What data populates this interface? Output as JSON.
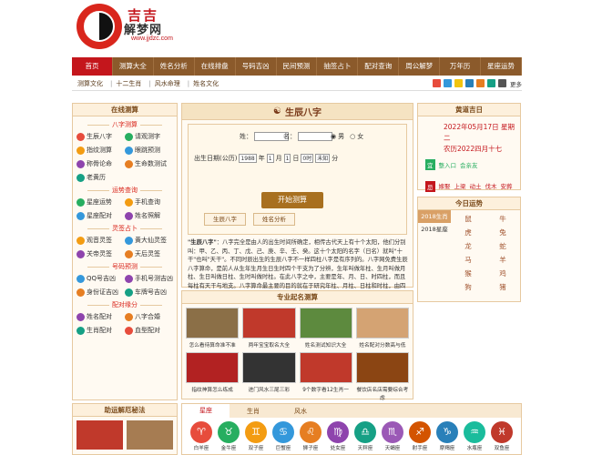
{
  "site": {
    "title": "吉吉",
    "title2": "解梦网",
    "url": "www.jjdzc.com"
  },
  "nav": [
    "首页",
    "测算大全",
    "姓名分析",
    "在线排盘",
    "号码吉凶",
    "民间预测",
    "抽签占卜",
    "配对查询",
    "周公解梦",
    "万年历",
    "星座运势"
  ],
  "subnav": [
    "测算文化",
    "十二生肖",
    "风水命理",
    "姓名文化"
  ],
  "share_more": "更多",
  "left": {
    "title": "在线测算",
    "sections": [
      {
        "name": "八字测算",
        "items": [
          "生辰八字",
          "请观测字",
          "指纹测算",
          "眼跳预测",
          "称骨论命",
          "生命数测试",
          "老黄历"
        ]
      },
      {
        "name": "运势查询",
        "items": [
          "星座运势",
          "手机查询",
          "星座配对",
          "姓名照解"
        ]
      },
      {
        "name": "灵签占卜",
        "items": [
          "观音灵签",
          "黄大仙灵签",
          "关帝灵签",
          "天后灵签"
        ]
      },
      {
        "name": "号码预测",
        "items": [
          "QQ号吉凶",
          "手机号测吉凶",
          "身份证吉凶",
          "车牌号吉凶"
        ]
      },
      {
        "name": "配对缘分",
        "items": [
          "姓名配对",
          "八字合婚",
          "生肖配对",
          "血型配对"
        ]
      }
    ],
    "bottom_title": "助运解厄秘法"
  },
  "center": {
    "title": "生辰八字",
    "surname_label": "姓：",
    "name_label": "名：",
    "male": "男",
    "female": "女",
    "birth_label": "出生日期(公历)",
    "year": "1988",
    "year_unit": "年",
    "month": "1",
    "month_unit": "月",
    "day": "1",
    "day_unit": "日",
    "hour": "0时",
    "minute": "未知",
    "minute_unit": "分",
    "button": "开始测算",
    "tab1": "生辰八字",
    "tab2": "姓名分析",
    "desc_bold": "\"生辰八字\"",
    "desc": "：八字完全是由人的出生时间所确定，相传古代天上有十个太阳，他们分别叫：甲、乙、丙、丁、戊、己、庚、辛、壬、癸。这十个太阳的名字（日名）就叫\"十干\"也叫\"天干\"。不同时辰出生的生辰八字不一样四柱八字是有序列的。八字网免费生辰八字算命，是前人从生年生月生日生时四个干支为了分辨，生年叫做年柱、生月叫做月柱、生日叫做日柱、生时叫做时柱。在此八字之中，主要是年、月、日、时四柱，而且每柱有天干与地支。八字算命最主要的目的就在于研究年柱、月柱、日柱和时柱，由四柱推算八字的命运。"
  },
  "mid2": {
    "title": "专业起名测算",
    "thumbs": [
      "怎么看待算命准不准",
      "两年宝宝取名大全",
      "姓名测试知识大全",
      "姓名配对分数高与低",
      "指纹神算怎么练成",
      "进门风水三尾三彩",
      "9个数字看12生肖一",
      "餐饮店名店需要综合考虑"
    ]
  },
  "right1": {
    "title": "黄道吉日",
    "date": "2022年05月17日 星期二",
    "lunar": "农历2022四月十七",
    "yi_label": "宜",
    "ji_label": "忌",
    "yi": [
      "整入口",
      "会亲友"
    ],
    "ji": [
      "嫁娶",
      "上梁",
      "动土",
      "伐木",
      "安葬"
    ]
  },
  "right2": {
    "title": "今日运势",
    "years": [
      "2018生肖",
      "2018星座"
    ],
    "animals": [
      "鼠",
      "牛",
      "虎",
      "兔",
      "龙",
      "蛇",
      "马",
      "羊",
      "猴",
      "鸡",
      "狗",
      "猪"
    ]
  },
  "zodiac": {
    "tabs": [
      "星座",
      "生肖",
      "风水"
    ],
    "signs": [
      "白羊座",
      "金牛座",
      "双子座",
      "巨蟹座",
      "狮子座",
      "处女座",
      "天秤座",
      "天蝎座",
      "射手座",
      "摩羯座",
      "水瓶座",
      "双鱼座"
    ],
    "glyphs": [
      "♈",
      "♉",
      "♊",
      "♋",
      "♌",
      "♍",
      "♎",
      "♏",
      "♐",
      "♑",
      "♒",
      "♓"
    ],
    "colors": [
      "#e74c3c",
      "#27ae60",
      "#f39c12",
      "#3498db",
      "#e67e22",
      "#8e44ad",
      "#16a085",
      "#9b59b6",
      "#d35400",
      "#2980b9",
      "#1abc9c",
      "#c0392b"
    ]
  }
}
